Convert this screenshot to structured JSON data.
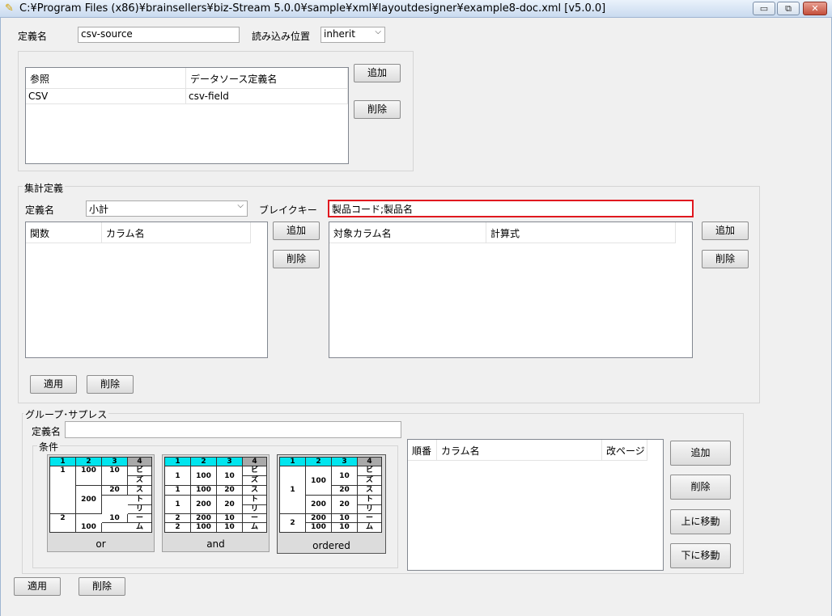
{
  "window": {
    "title": "C:¥Program Files (x86)¥brainsellers¥biz-Stream 5.0.0¥sample¥xml¥layoutdesigner¥example8-doc.xml [v5.0.0]",
    "minimize": "▭",
    "restore": "⧉",
    "close": "✕"
  },
  "definition": {
    "name_label": "定義名",
    "name_value": "csv-source",
    "load_position_label": "読み込み位置",
    "load_position_value": "inherit"
  },
  "reference_table": {
    "headers": [
      "参照",
      "データソース定義名"
    ],
    "rows": [
      [
        "CSV",
        "csv-field"
      ]
    ],
    "add_label": "追加",
    "delete_label": "削除"
  },
  "aggregate": {
    "group_label": "集計定義",
    "name_label": "定義名",
    "name_value": "小計",
    "breakkey_label": "ブレイクキー",
    "breakkey_value": "製品コード;製品名",
    "func_table_headers": [
      "関数",
      "カラム名"
    ],
    "target_table_headers": [
      "対象カラム名",
      "計算式"
    ],
    "add_label": "追加",
    "delete_label": "削除",
    "apply_label": "適用",
    "delete2_label": "削除"
  },
  "group_suppress": {
    "group_label": "グループ･サプレス",
    "name_label": "定義名",
    "name_value": "",
    "condition_label": "条件",
    "options": [
      {
        "label": "or",
        "headers": [
          "1",
          "2",
          "3",
          "4"
        ],
        "cells": [
          "1",
          "100",
          "10",
          "ビ",
          "ズ",
          "20",
          "ス",
          "200",
          "ト",
          "リ",
          "2",
          "10",
          "ー",
          "100",
          "ム"
        ]
      },
      {
        "label": "and",
        "headers": [
          "1",
          "2",
          "3",
          "4"
        ],
        "cells": [
          "1",
          "100",
          "10",
          "ビ",
          "ズ",
          "1",
          "100",
          "20",
          "ス",
          "1",
          "200",
          "20",
          "ト",
          "リ",
          "2",
          "200",
          "10",
          "ー",
          "2",
          "100",
          "10",
          "ム"
        ]
      },
      {
        "label": "ordered",
        "headers": [
          "1",
          "2",
          "3",
          "4"
        ],
        "cells": [
          "1",
          "100",
          "10",
          "ビ",
          "ズ",
          "20",
          "ス",
          "200",
          "20",
          "ト",
          "リ",
          "2",
          "200",
          "10",
          "ー",
          "100",
          "10",
          "ム"
        ]
      }
    ],
    "table_headers": [
      "順番",
      "カラム名",
      "改ページ"
    ],
    "add_label": "追加",
    "delete_label": "削除",
    "move_up_label": "上に移動",
    "move_down_label": "下に移動"
  },
  "footer": {
    "apply_label": "適用",
    "delete_label": "削除"
  },
  "colors": {
    "header_cyan": "#00e5ee",
    "header_gray": "#a9a9a9",
    "highlight_red": "#e0181f"
  }
}
